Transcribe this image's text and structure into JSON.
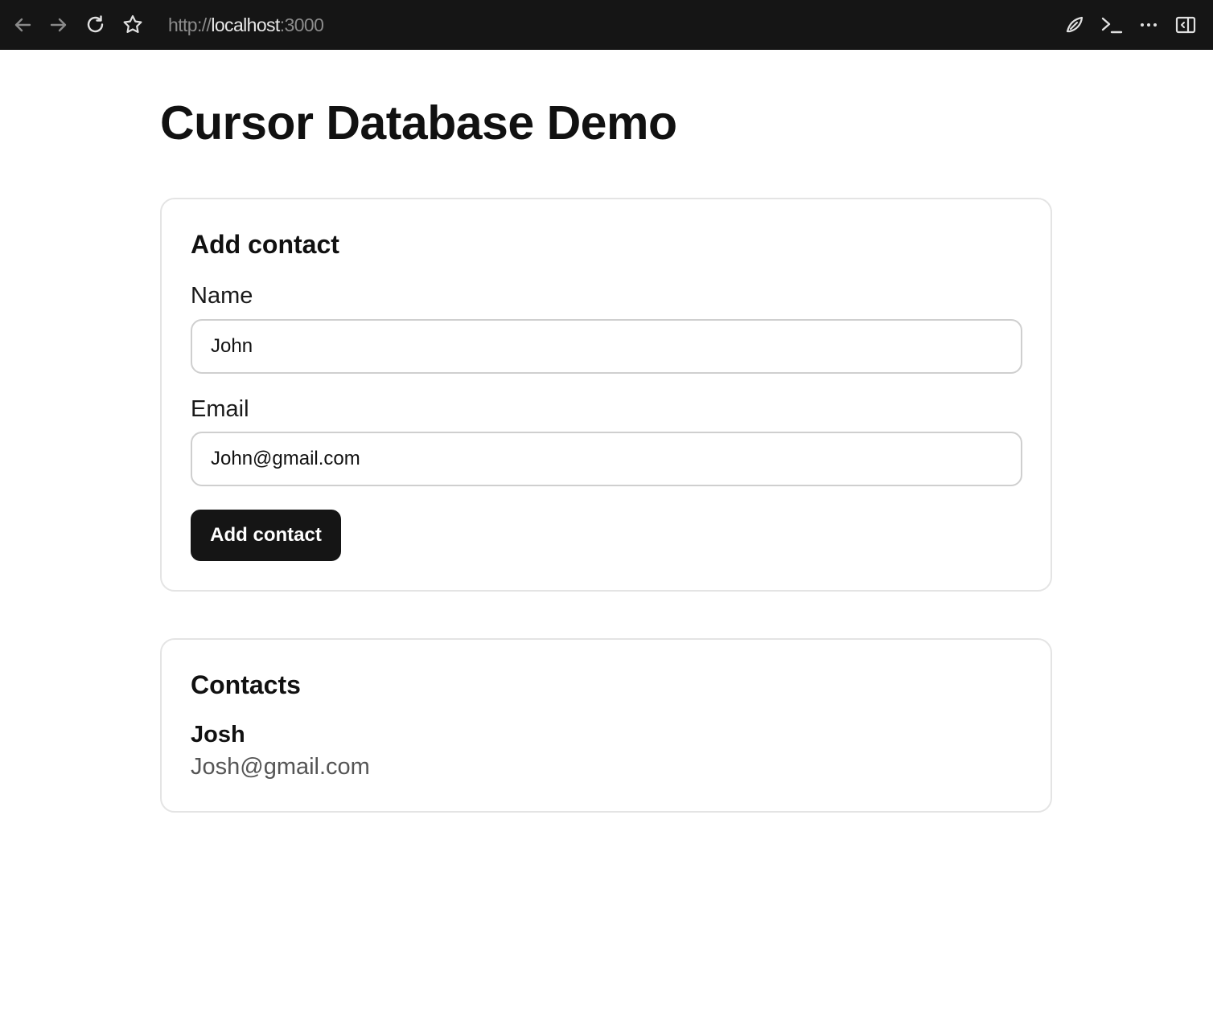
{
  "browser": {
    "url_scheme": "http://",
    "url_host": "localhost",
    "url_port": ":3000",
    "icons": [
      "back-arrow-icon",
      "forward-arrow-icon",
      "reload-icon",
      "bookmark-star-icon",
      "extension-icon",
      "terminal-icon",
      "more-options-icon",
      "sidebar-toggle-icon"
    ]
  },
  "page": {
    "title": "Cursor Database Demo"
  },
  "add_contact": {
    "heading": "Add contact",
    "name_label": "Name",
    "name_value": "John",
    "email_label": "Email",
    "email_value": "John@gmail.com",
    "submit_label": "Add contact"
  },
  "contacts": {
    "heading": "Contacts",
    "items": [
      {
        "name": "Josh",
        "email": "Josh@gmail.com"
      }
    ]
  }
}
